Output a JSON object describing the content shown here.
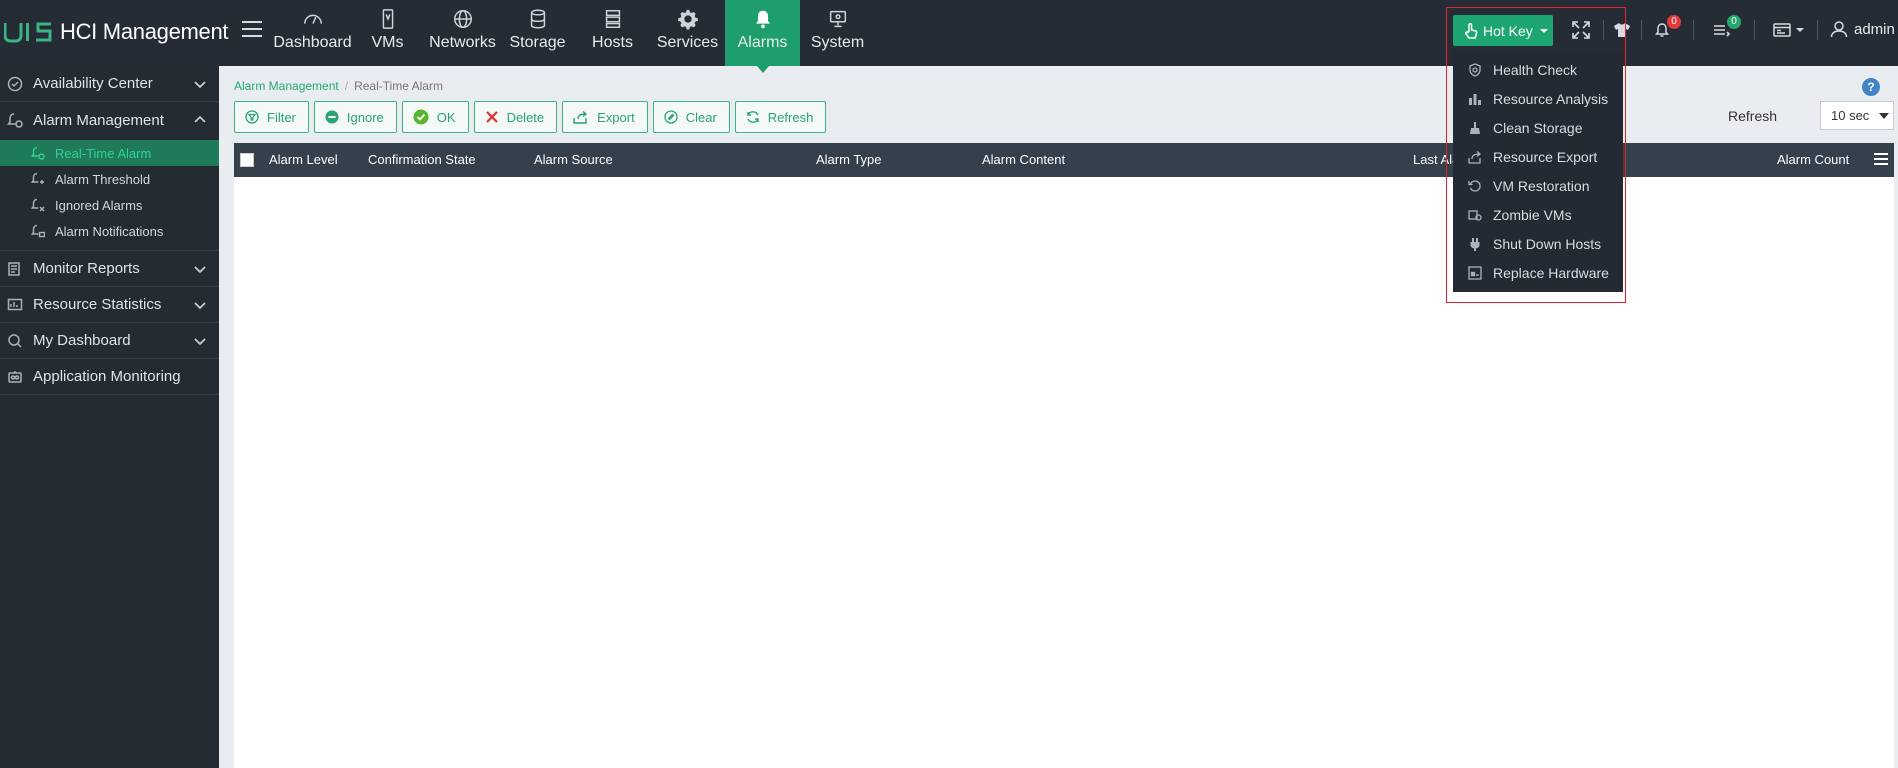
{
  "app": {
    "logo_mark": "UIS",
    "title": "HCI Management"
  },
  "nav": [
    {
      "label": "Dashboard",
      "icon": "dashboard-gauge-icon"
    },
    {
      "label": "VMs",
      "icon": "vm-icon"
    },
    {
      "label": "Networks",
      "icon": "globe-icon"
    },
    {
      "label": "Storage",
      "icon": "database-icon"
    },
    {
      "label": "Hosts",
      "icon": "server-icon"
    },
    {
      "label": "Services",
      "icon": "gear-icon"
    },
    {
      "label": "Alarms",
      "icon": "bell-icon",
      "active": true
    },
    {
      "label": "System",
      "icon": "monitor-icon"
    }
  ],
  "header": {
    "hotkey_label": "Hot Key",
    "alarm_count": "0",
    "task_count": "0",
    "user": "admin"
  },
  "hotkey_menu": [
    {
      "label": "Health Check",
      "icon": "shield-icon"
    },
    {
      "label": "Resource Analysis",
      "icon": "bar-chart-icon"
    },
    {
      "label": "Clean Storage",
      "icon": "broom-icon"
    },
    {
      "label": "Resource Export",
      "icon": "export-icon"
    },
    {
      "label": "VM Restoration",
      "icon": "restore-icon"
    },
    {
      "label": "Zombie VMs",
      "icon": "zombie-vm-icon"
    },
    {
      "label": "Shut Down Hosts",
      "icon": "power-plug-icon"
    },
    {
      "label": "Replace Hardware",
      "icon": "hardware-icon"
    }
  ],
  "sidebar": {
    "groups": [
      {
        "label": "Availability Center",
        "icon": "availability-icon",
        "expanded": false
      },
      {
        "label": "Alarm Management",
        "icon": "alarm-management-icon",
        "expanded": true
      },
      {
        "label": "Monitor Reports",
        "icon": "report-icon",
        "expanded": false
      },
      {
        "label": "Resource Statistics",
        "icon": "statistics-icon",
        "expanded": false
      },
      {
        "label": "My Dashboard",
        "icon": "my-dashboard-icon",
        "expanded": false
      },
      {
        "label": "Application Monitoring",
        "icon": "app-monitoring-icon",
        "expanded": false
      }
    ],
    "alarm_items": [
      {
        "label": "Real-Time Alarm",
        "active": true
      },
      {
        "label": "Alarm Threshold"
      },
      {
        "label": "Ignored Alarms"
      },
      {
        "label": "Alarm Notifications"
      }
    ]
  },
  "breadcrumb": {
    "parent": "Alarm Management",
    "current": "Real-Time Alarm"
  },
  "toolbar": {
    "filter": "Filter",
    "ignore": "Ignore",
    "ok": "OK",
    "delete": "Delete",
    "export": "Export",
    "clear": "Clear",
    "refresh": "Refresh"
  },
  "refresh": {
    "label": "Refresh",
    "value": "10 sec"
  },
  "table": {
    "columns": [
      "Alarm Level",
      "Confirmation State",
      "Alarm Source",
      "Alarm Type",
      "Alarm Content",
      "Last Alarm Time",
      "Alarm Count"
    ],
    "rows": []
  },
  "colors": {
    "accent": "#1ea672",
    "topbar": "#262c35",
    "sidebar": "#252b33",
    "table_header": "#35404d",
    "highlight_frame": "#e0242c"
  }
}
